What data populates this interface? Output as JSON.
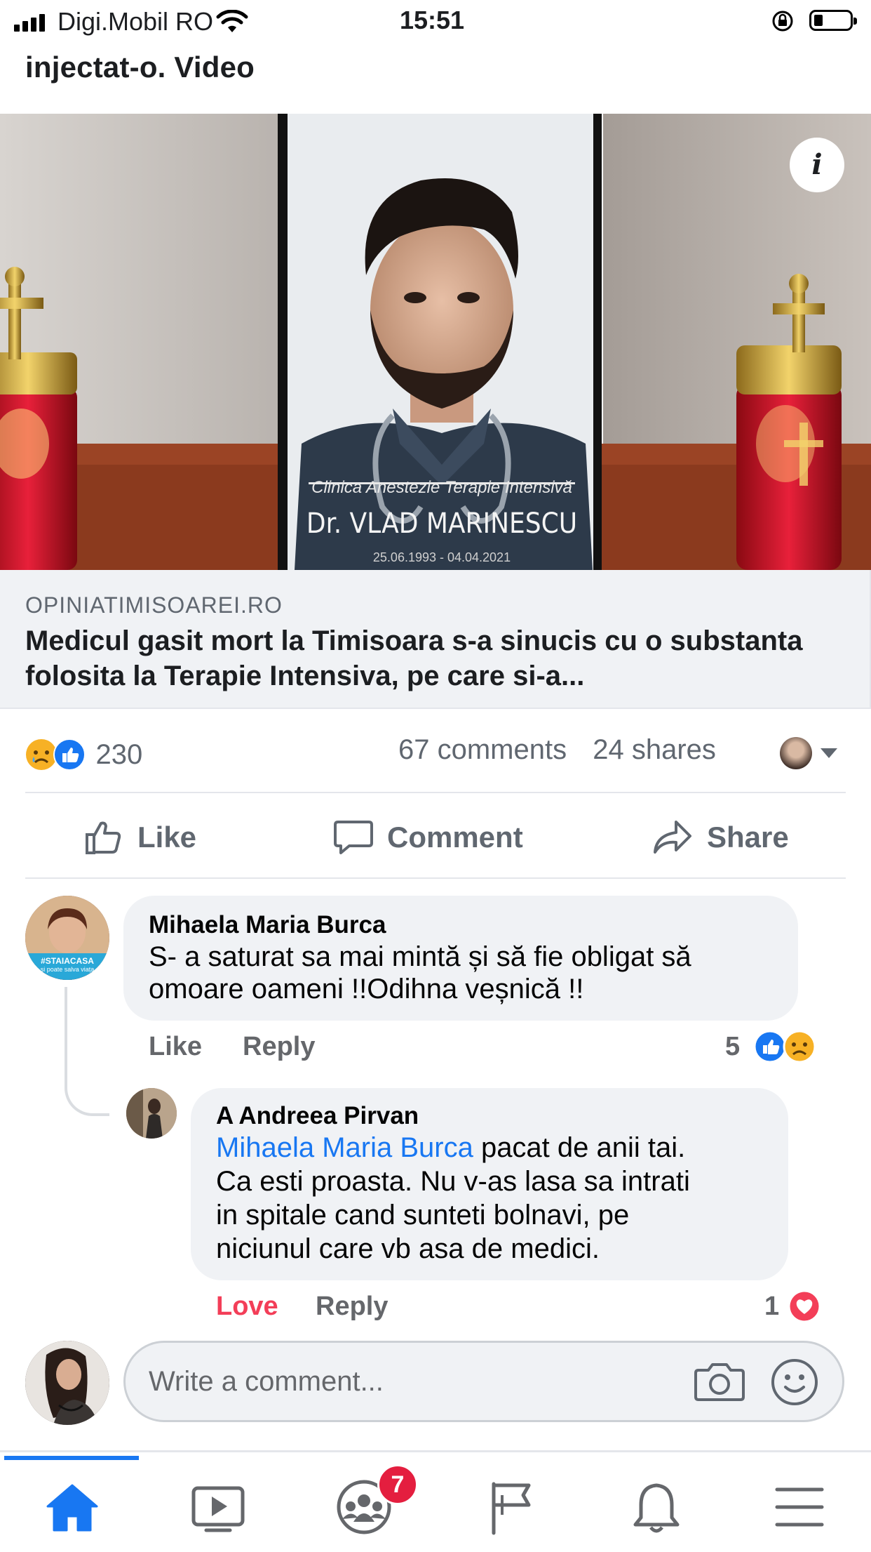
{
  "status_bar": {
    "carrier": "Digi.Mobil RO",
    "time": "15:51"
  },
  "post": {
    "headline_tail": "injectat-o. Video",
    "image": {
      "caption_line1": "Clinica Anestezie Terapie Intensivă",
      "caption_name": "Dr. VLAD MARINESCU",
      "caption_dates": "25.06.1993 - 04.04.2021"
    },
    "link": {
      "domain": "OPINIATIMISOAREI.RO",
      "title": "Medicul gasit mort la Timisoara s-a sinucis cu o substanta folosita la Terapie Intensiva, pe care si-a..."
    },
    "reactions_count": "230",
    "comments_count": "67 comments",
    "shares_count": "24 shares",
    "actions": {
      "like": "Like",
      "comment": "Comment",
      "share": "Share"
    }
  },
  "comments": [
    {
      "author": "Mihaela Maria Burca",
      "text_line1": "S- a saturat sa mai mintă și să fie obligat să",
      "text_line2": "omoare oameni !!Odihna veșnică !!",
      "avatar_badge": "#STAIACASA",
      "avatar_badge_sub": "și poate salva viața",
      "like_label": "Like",
      "reply_label": "Reply",
      "reaction_count": "5"
    },
    {
      "author": "A Andreea Pirvan",
      "mention": "Mihaela Maria Burca",
      "text_line1": " pacat de anii tai.",
      "text_line2": "Ca esti proasta. Nu v-as lasa sa intrati",
      "text_line3": "in spitale cand sunteti bolnavi, pe",
      "text_line4": "niciunul care vb asa de medici.",
      "love_label": "Love",
      "reply_label": "Reply",
      "reaction_count": "1"
    }
  ],
  "composer": {
    "placeholder": "Write a comment..."
  },
  "tabbar": {
    "groups_badge": "7"
  },
  "colors": {
    "accent": "#1877f2",
    "love": "#f33e58",
    "text_secondary": "#65676b"
  }
}
